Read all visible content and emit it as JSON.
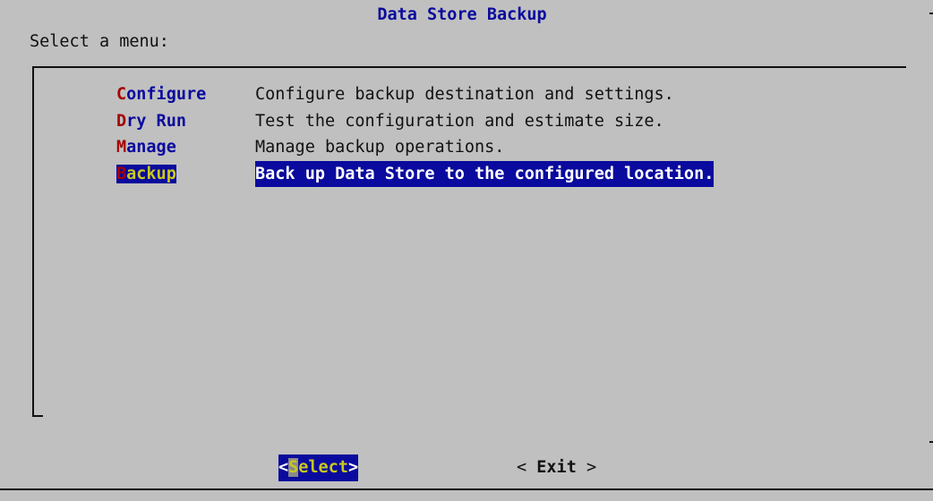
{
  "dialog": {
    "title": "Data Store Backup",
    "prompt": "Select a menu:"
  },
  "menu": {
    "selected_index": 3,
    "items": [
      {
        "hotkey": "C",
        "rest": "onfigure",
        "description": "Configure backup destination and settings."
      },
      {
        "hotkey": "D",
        "rest": "ry Run",
        "description": "Test the configuration and estimate size."
      },
      {
        "hotkey": "M",
        "rest": "anage",
        "description": "Manage backup operations."
      },
      {
        "hotkey": "B",
        "rest": "ackup",
        "description": "Back up Data Store to the configured location."
      }
    ]
  },
  "buttons": {
    "select": {
      "left": "<",
      "hotkey": "S",
      "rest": "elect",
      "right": ">"
    },
    "exit": {
      "left": "< ",
      "label": "Exit",
      "right": " >"
    }
  },
  "colors": {
    "background": "#c0c0c0",
    "title": "#0a0a9e",
    "hotkey": "#a50000",
    "highlight_bg": "#0a0a9e",
    "highlight_fg": "#c8c81e"
  }
}
